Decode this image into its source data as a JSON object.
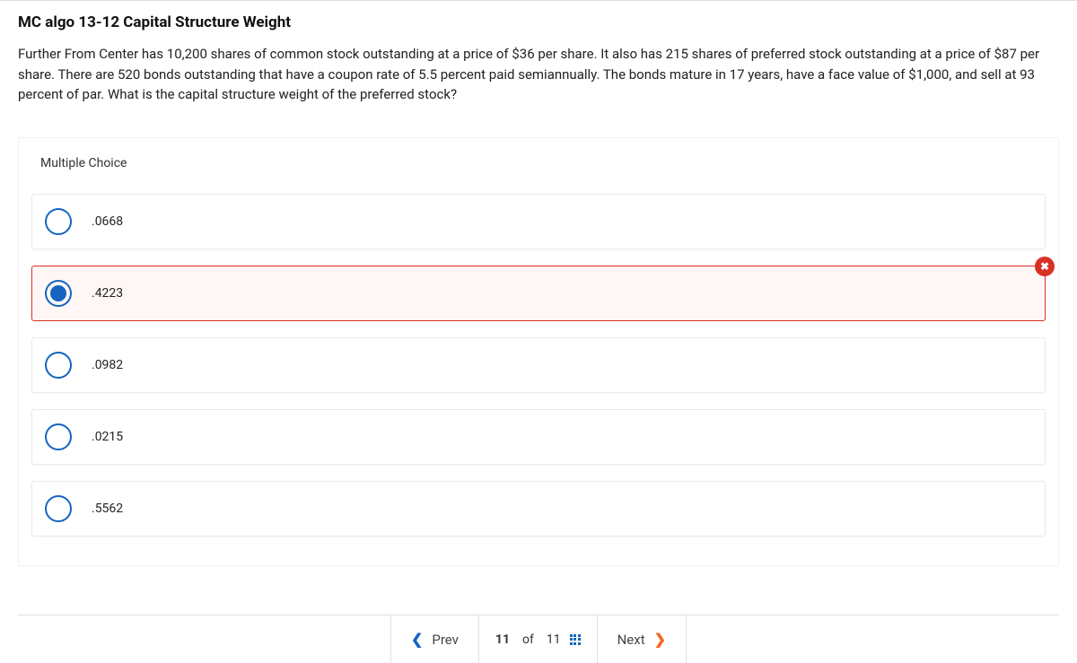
{
  "title": "MC algo 13-12 Capital Structure Weight",
  "prompt": "Further From Center has 10,200 shares of common stock outstanding at a price of $36 per share. It also has 215 shares of preferred stock outstanding at a price of $87 per share. There are 520 bonds outstanding that have a coupon rate of 5.5 percent paid semiannually. The bonds mature in 17 years, have a face value of $1,000, and sell at 93 percent of par. What is the capital structure weight of the preferred stock?",
  "mc_header": "Multiple Choice",
  "choices": [
    {
      "label": ".0668",
      "selected": false,
      "incorrect": false
    },
    {
      "label": ".4223",
      "selected": true,
      "incorrect": true
    },
    {
      "label": ".0982",
      "selected": false,
      "incorrect": false
    },
    {
      "label": ".0215",
      "selected": false,
      "incorrect": false
    },
    {
      "label": ".5562",
      "selected": false,
      "incorrect": false
    }
  ],
  "feedback_symbol": "✖",
  "nav": {
    "prev_label": "Prev",
    "next_label": "Next",
    "current": "11",
    "of_label": "of",
    "total": "11"
  }
}
